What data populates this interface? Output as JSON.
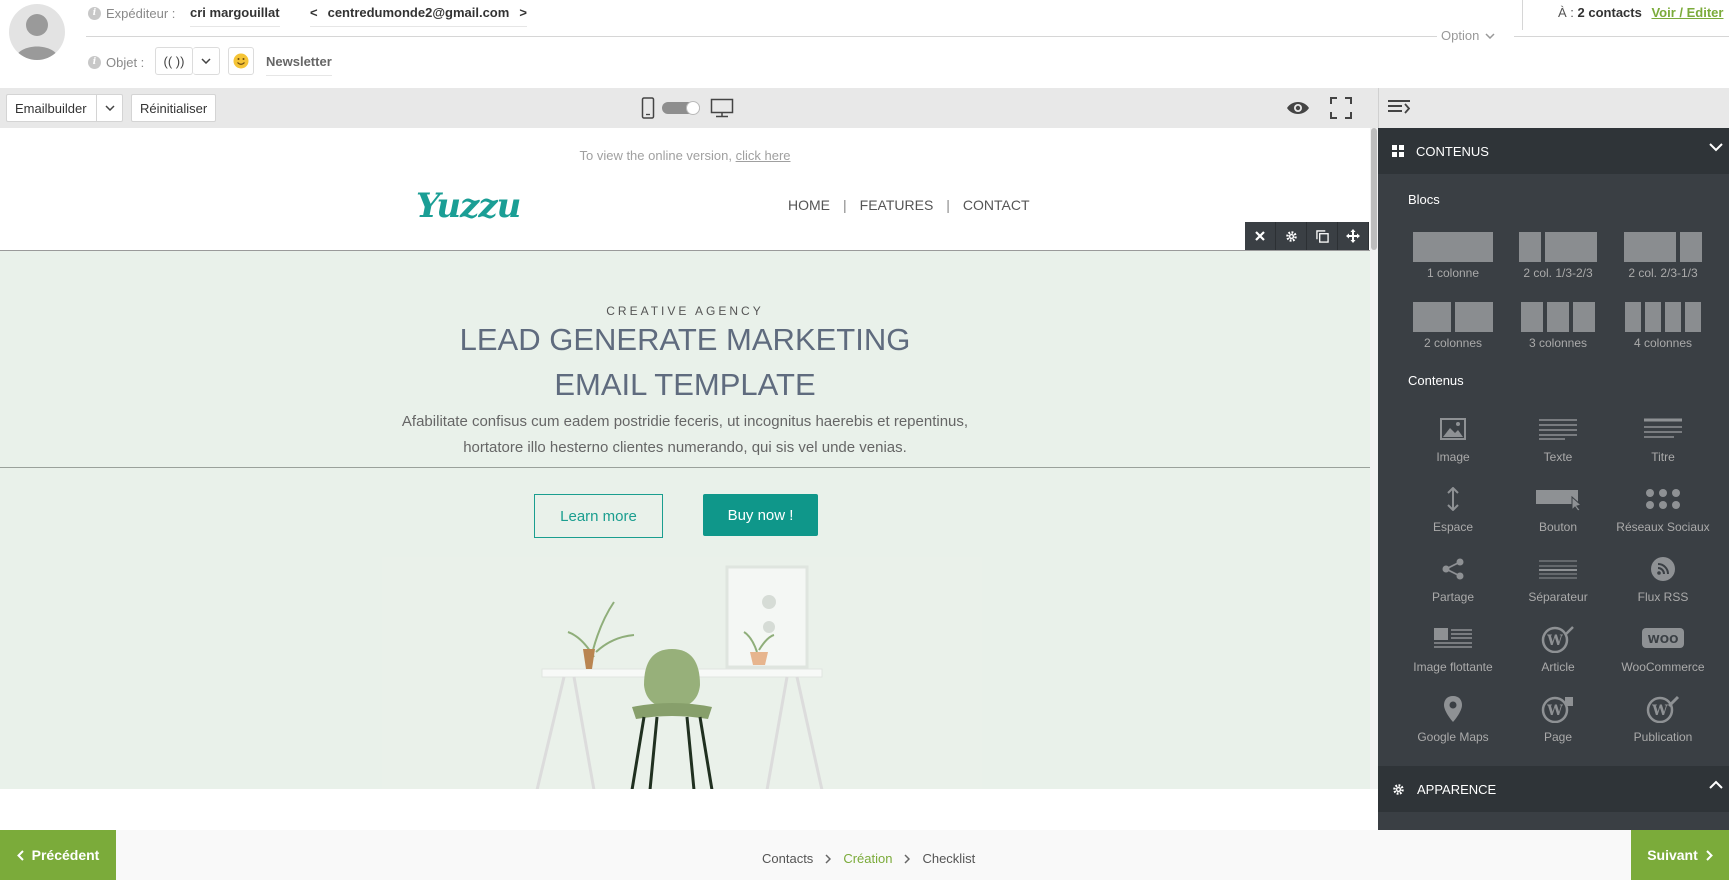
{
  "header": {
    "sender_label": "Expéditeur :",
    "sender_name": "cri margouillat",
    "sender_email_open": "<",
    "sender_email": "centredumonde2@gmail.com",
    "sender_email_close": ">",
    "subject_label": "Objet :",
    "personalize": "(( ))",
    "subject_value": "Newsletter",
    "option_label": "Option",
    "to_label": "À :",
    "to_value": "2 contacts",
    "edit_link": "Voir / Editer"
  },
  "toolbar": {
    "builder": "Emailbuilder",
    "reset": "Réinitialiser"
  },
  "email": {
    "online_prefix": "To view the online version,",
    "online_link": "click here",
    "logo": "Yuzzu",
    "nav": [
      "HOME",
      "FEATURES",
      "CONTACT"
    ],
    "nav_sep": "|",
    "eyebrow": "CREATIVE AGENCY",
    "title_line1": "LEAD GENERATE MARKETING",
    "title_line2": "EMAIL TEMPLATE",
    "para_line1": "Afabilitate confisus cum eadem postridie feceris, ut incognitus haerebis et repentinus,",
    "para_line2": "hortatore illo hesterno clientes numerando, qui sis vel unde venias.",
    "btn_learn": "Learn more",
    "btn_buy": "Buy now !"
  },
  "panel": {
    "contents_header": "CONTENUS",
    "blocks_title": "Blocs",
    "layouts": [
      "1 colonne",
      "2 col. 1/3-2/3",
      "2 col. 2/3-1/3",
      "2 colonnes",
      "3 colonnes",
      "4 colonnes"
    ],
    "contents_title": "Contenus",
    "items": [
      "Image",
      "Texte",
      "Titre",
      "Espace",
      "Bouton",
      "Réseaux Sociaux",
      "Partage",
      "Séparateur",
      "Flux RSS",
      "Image flottante",
      "Article",
      "WooCommerce",
      "Google Maps",
      "Page",
      "Publication"
    ],
    "appearance_header": "APPARENCE"
  },
  "footer": {
    "prev": "Précédent",
    "next": "Suivant",
    "steps": [
      "Contacts",
      "Création",
      "Checklist"
    ],
    "active_step": "Création"
  },
  "colors": {
    "accent_green": "#7bab3a",
    "teal": "#0f978a",
    "panel_bg": "#3a3f44",
    "hero_bg": "#e9f1ea"
  }
}
